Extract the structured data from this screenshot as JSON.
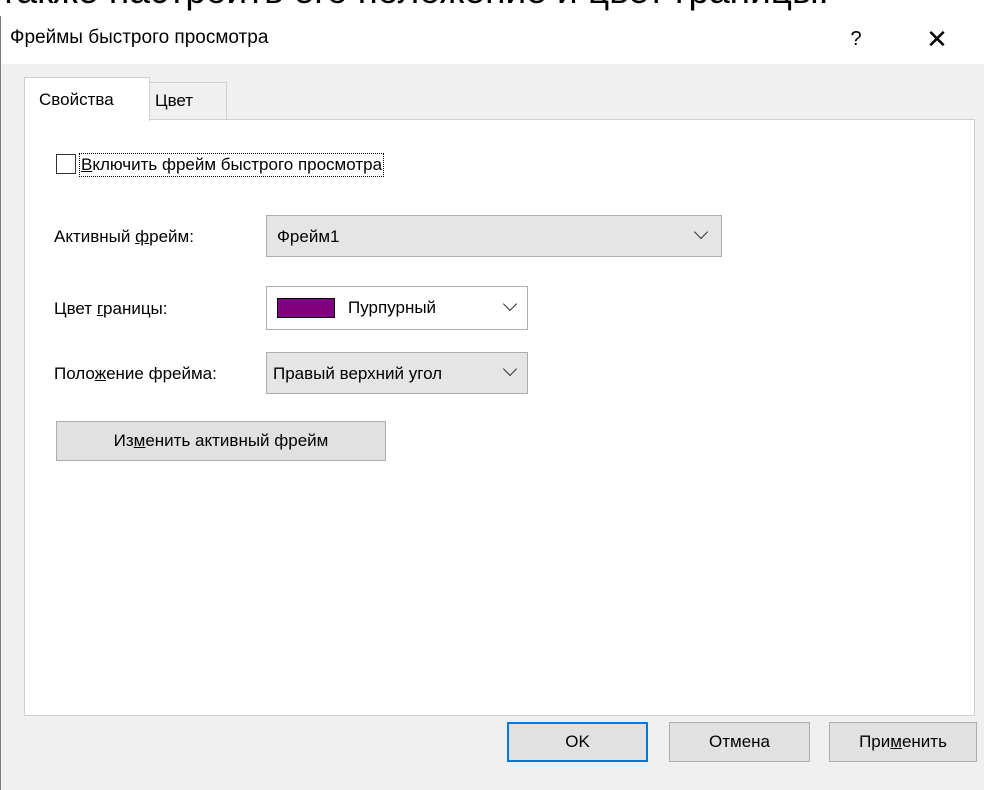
{
  "background_text": "также настроить его положение и цвет границы.",
  "window": {
    "title": "Фреймы быстрого просмотра",
    "help_label": "?",
    "close_label": "✕"
  },
  "tabs": [
    {
      "label": "Свойства",
      "active": true
    },
    {
      "label": "Цвет",
      "active": false
    }
  ],
  "properties": {
    "enable_checkbox": {
      "pre": "",
      "accel": "В",
      "post": "ключить фрейм быстрого просмотра",
      "checked": false
    },
    "active_frame": {
      "label_pre": "Активный ",
      "label_accel": "ф",
      "label_post": "рейм:",
      "value": "Фрейм1"
    },
    "border_color": {
      "label_pre": "Цвет ",
      "label_accel": "г",
      "label_post": "раницы:",
      "value": "Пурпурный",
      "swatch": "#800080"
    },
    "frame_position": {
      "label_pre": "Поло",
      "label_accel": "ж",
      "label_post": "ение фрейма:",
      "value": "Правый верхний угол"
    },
    "change_button": {
      "pre": "Из",
      "accel": "м",
      "post": "енить активный фрейм"
    }
  },
  "footer": {
    "ok": "OK",
    "cancel": "Отмена",
    "apply": {
      "pre": "При",
      "accel": "м",
      "post": "енить"
    }
  },
  "colors": {
    "dialog_bg": "#f0f0f0",
    "panel_bg": "#ffffff",
    "default_button_border": "#0078d7",
    "swatch_purple": "#800080"
  },
  "icons": {
    "close": "close-icon",
    "dropdown": "chevron-down-icon",
    "color_swatch": "color-swatch"
  }
}
